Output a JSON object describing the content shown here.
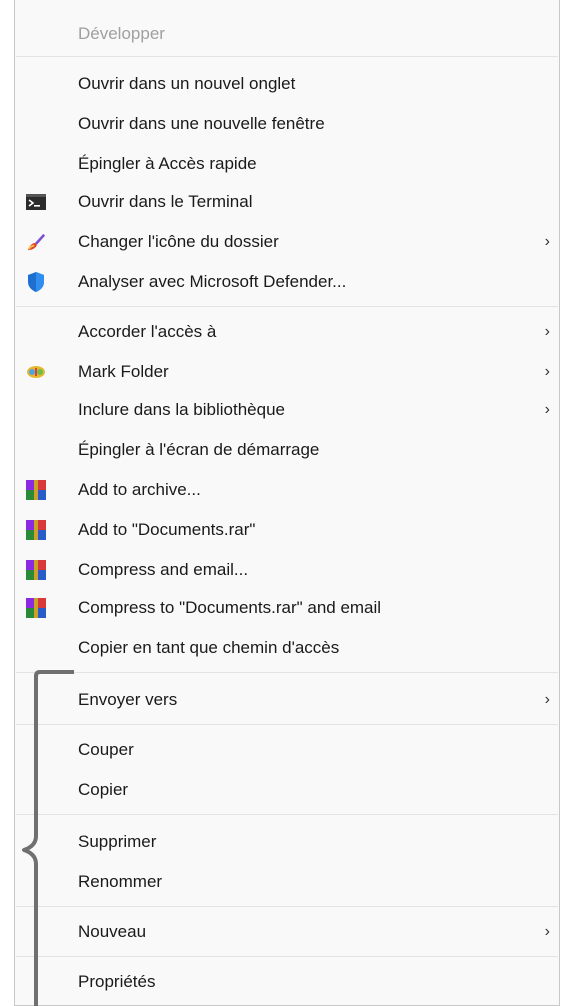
{
  "menu": {
    "items": [
      {
        "label": "Développer",
        "icon": "",
        "submenu": false,
        "disabled": true
      },
      {
        "label": "Ouvrir dans un nouvel onglet",
        "icon": "",
        "submenu": false
      },
      {
        "label": "Ouvrir dans une nouvelle fenêtre",
        "icon": "",
        "submenu": false
      },
      {
        "label": "Épingler à Accès rapide",
        "icon": "",
        "submenu": false
      },
      {
        "label": "Ouvrir dans le Terminal",
        "icon": "terminal-icon",
        "submenu": false
      },
      {
        "label": "Changer l'icône du dossier",
        "icon": "paint-brush-icon",
        "submenu": true
      },
      {
        "label": "Analyser avec Microsoft Defender...",
        "icon": "defender-shield-icon",
        "submenu": false
      },
      {
        "label": "Accorder l'accès à",
        "icon": "",
        "submenu": true
      },
      {
        "label": "Mark Folder",
        "icon": "mark-folder-icon",
        "submenu": true
      },
      {
        "label": "Inclure dans la bibliothèque",
        "icon": "",
        "submenu": true
      },
      {
        "label": "Épingler à l'écran de démarrage",
        "icon": "",
        "submenu": false
      },
      {
        "label": "Add to archive...",
        "icon": "winrar-icon",
        "submenu": false
      },
      {
        "label": "Add to \"Documents.rar\"",
        "icon": "winrar-icon",
        "submenu": false
      },
      {
        "label": "Compress and email...",
        "icon": "winrar-icon",
        "submenu": false
      },
      {
        "label": "Compress to \"Documents.rar\" and email",
        "icon": "winrar-icon",
        "submenu": false
      },
      {
        "label": "Copier en tant que chemin d'accès",
        "icon": "",
        "submenu": false
      },
      {
        "label": "Envoyer vers",
        "icon": "",
        "submenu": true
      },
      {
        "label": "Couper",
        "icon": "",
        "submenu": false
      },
      {
        "label": "Copier",
        "icon": "",
        "submenu": false
      },
      {
        "label": "Supprimer",
        "icon": "",
        "submenu": false
      },
      {
        "label": "Renommer",
        "icon": "",
        "submenu": false
      },
      {
        "label": "Nouveau",
        "icon": "",
        "submenu": true
      },
      {
        "label": "Propriétés",
        "icon": "",
        "submenu": false
      }
    ],
    "chevron": "›"
  }
}
